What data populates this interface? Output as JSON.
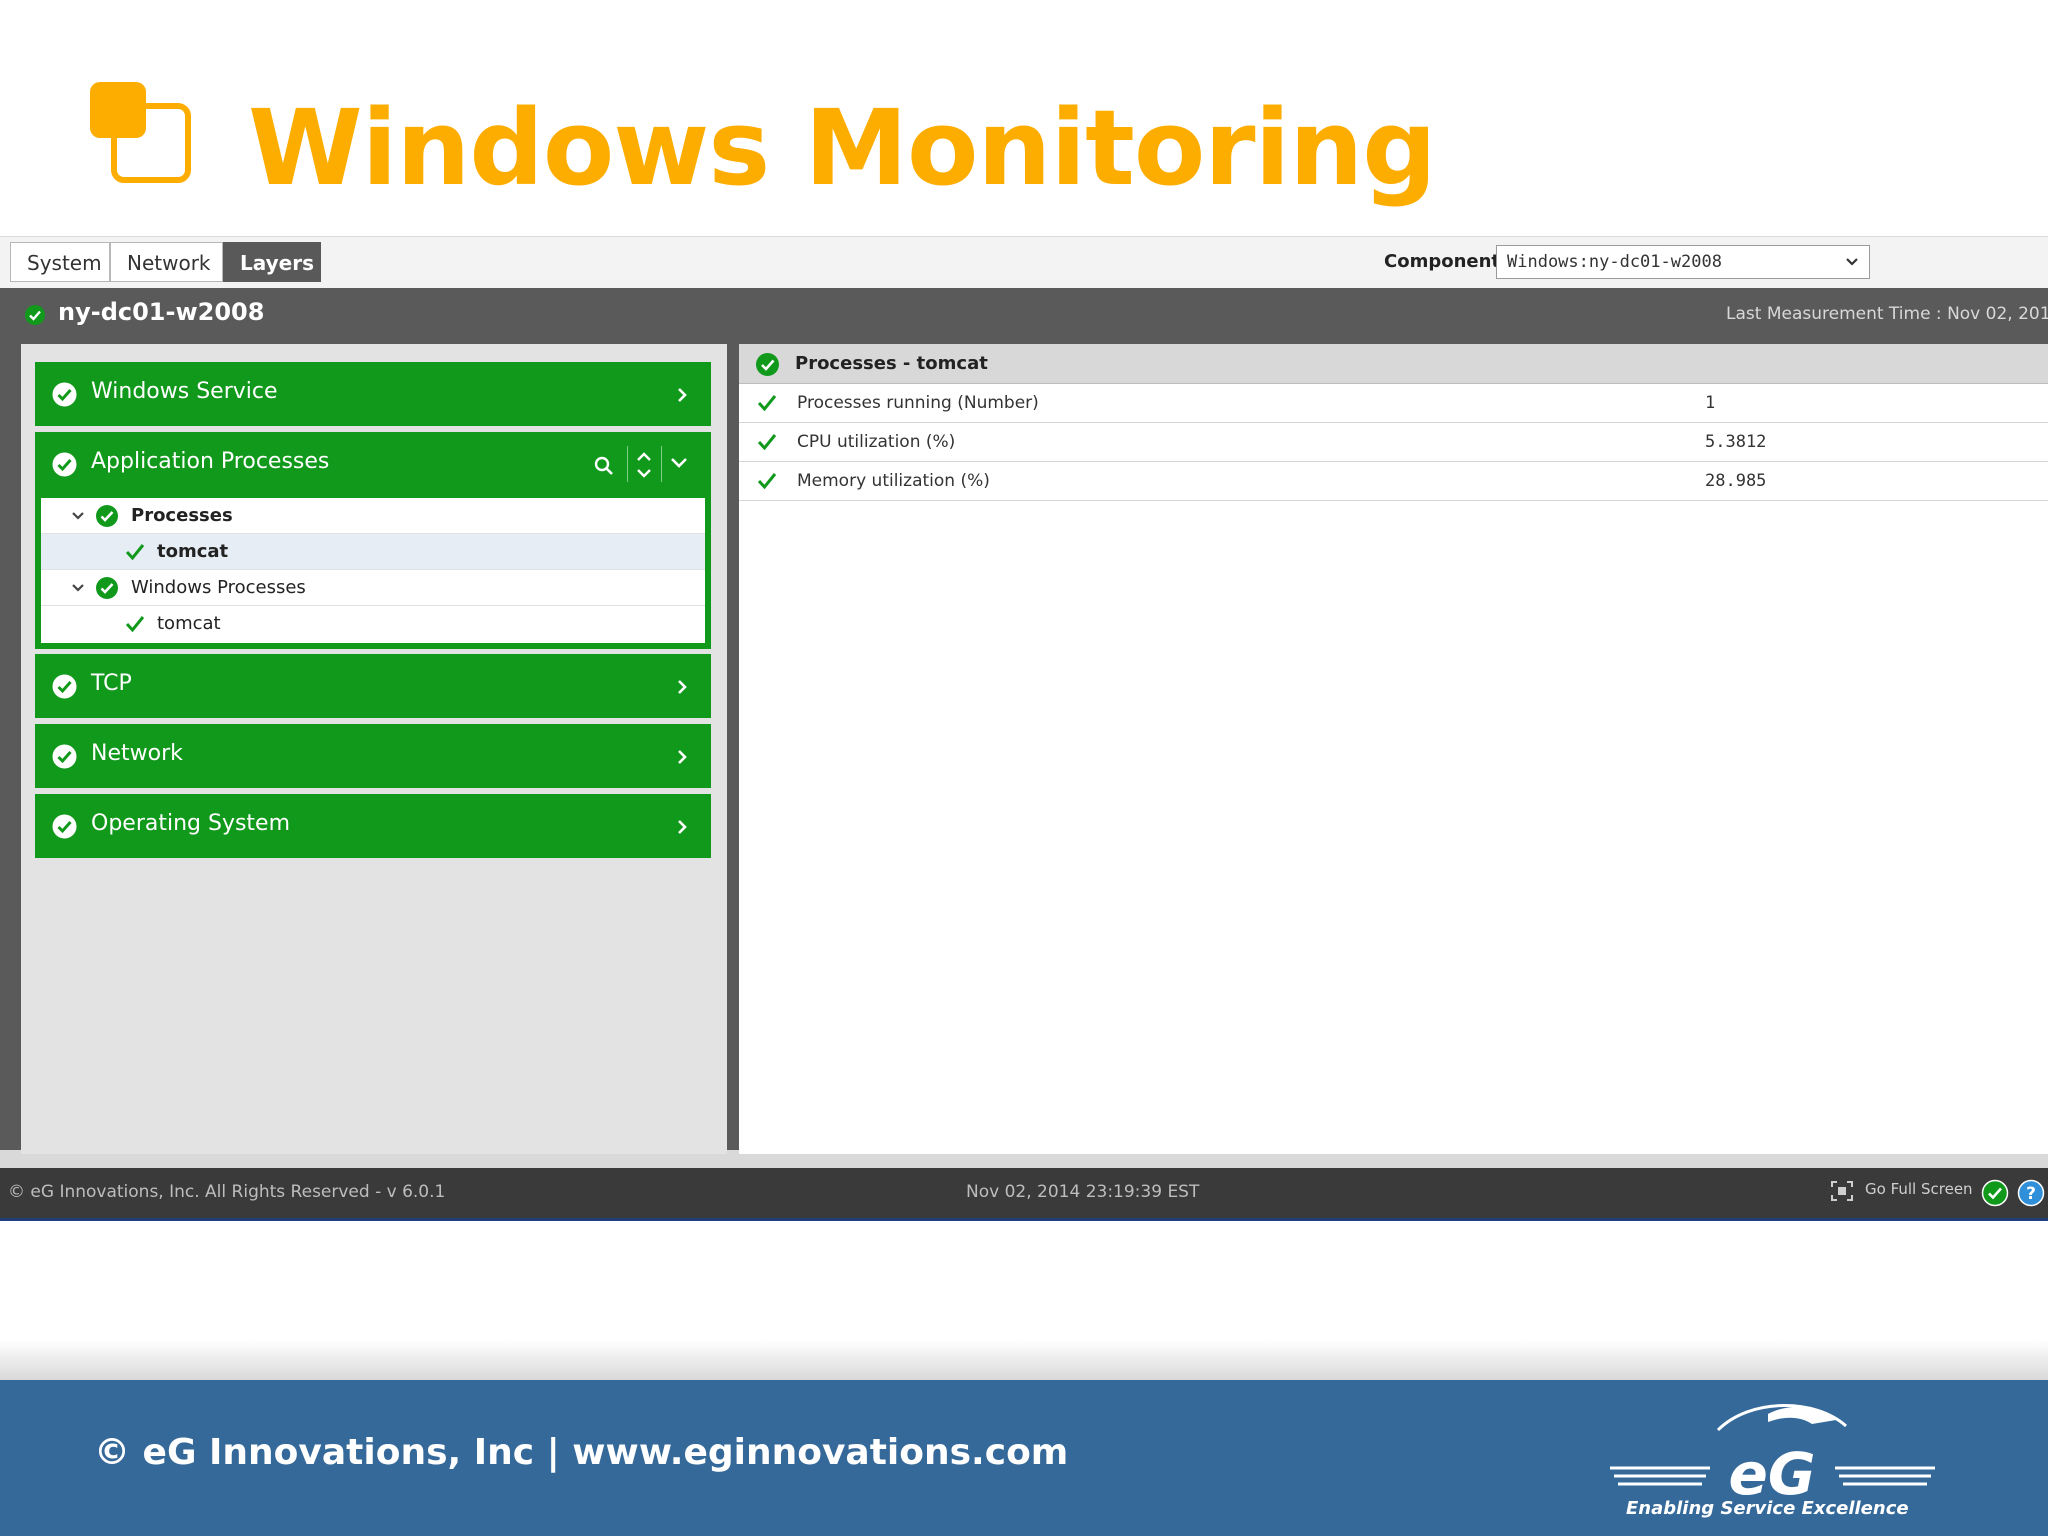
{
  "slide": {
    "title": "Windows Monitoring",
    "footer_text": "© eG Innovations, Inc  |  www.eginnovations.com",
    "logo_tagline": "Enabling Service Excellence",
    "logo_text": "eG"
  },
  "colors": {
    "title": "#fdad00",
    "layer_green": "#11991c",
    "band_blue": "#35699a",
    "header_dark": "#5a5a5a"
  },
  "tabs": [
    {
      "label": "System",
      "active": false
    },
    {
      "label": "Network",
      "active": false
    },
    {
      "label": "Layers",
      "active": true
    }
  ],
  "component": {
    "label": "Component",
    "value": "Windows:ny-dc01-w2008"
  },
  "host": {
    "name": "ny-dc01-w2008",
    "status": "ok",
    "last_measurement": "Last Measurement Time : Nov 02, 201"
  },
  "layers": {
    "windows_service": "Windows Service",
    "application_processes": "Application Processes",
    "tcp": "TCP",
    "network": "Network",
    "operating_system": "Operating System"
  },
  "tree": [
    {
      "label": "Processes",
      "level": 1,
      "bold": true
    },
    {
      "label": "tomcat",
      "level": 2,
      "bold": true,
      "selected": true
    },
    {
      "label": "Windows Processes",
      "level": 1,
      "bold": false
    },
    {
      "label": "tomcat",
      "level": 2,
      "bold": false
    }
  ],
  "details": {
    "header": "Processes - tomcat",
    "metrics": [
      {
        "name": "Processes running (Number)",
        "value": "1"
      },
      {
        "name": "CPU utilization (%)",
        "value": "5.3812"
      },
      {
        "name": "Memory utilization (%)",
        "value": "28.985"
      }
    ]
  },
  "status_bar": {
    "copyright": "© eG Innovations, Inc. All Rights Reserved - v 6.0.1",
    "timestamp": "Nov 02, 2014 23:19:39 EST",
    "fullscreen_label": "Go Full Screen"
  },
  "icons": [
    "check-circle-icon",
    "check-icon",
    "chevron-right-icon",
    "chevron-down-icon",
    "search-icon",
    "sort-icon",
    "fullscreen-icon",
    "help-icon"
  ]
}
